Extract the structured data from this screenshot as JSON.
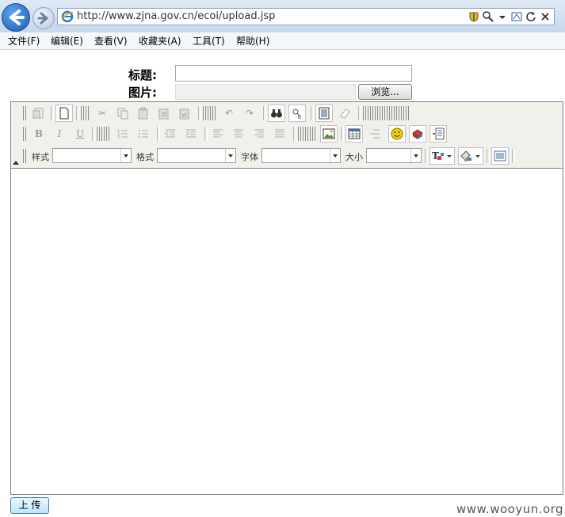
{
  "browser": {
    "url": "http://www.zjna.gov.cn/ecoi/upload.jsp",
    "menu": [
      "文件(F)",
      "编辑(E)",
      "查看(V)",
      "收藏夹(A)",
      "工具(T)",
      "帮助(H)"
    ]
  },
  "form": {
    "title_label": "标题:",
    "image_label": "图片:",
    "title_value": "",
    "browse_label": "浏览...",
    "submit_label": "上 传"
  },
  "editor": {
    "style_label": "样式",
    "format_label": "格式",
    "font_label": "字体",
    "size_label": "大小",
    "bold": "B",
    "italic": "I",
    "underline": "U"
  },
  "watermark": "www.wooyun.org"
}
